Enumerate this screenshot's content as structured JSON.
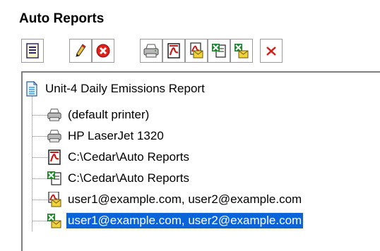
{
  "panel": {
    "title": "Auto Reports"
  },
  "toolbar": [
    {
      "name": "properties-button",
      "icon": "report-list-icon"
    },
    {
      "name": "edit-button",
      "icon": "pencil-icon"
    },
    {
      "name": "stop-button",
      "icon": "red-x-circle-icon"
    },
    {
      "name": "add-printer-button",
      "icon": "printer-icon"
    },
    {
      "name": "add-pdf-file-button",
      "icon": "pdf-file-icon"
    },
    {
      "name": "add-pdf-email-button",
      "icon": "pdf-email-icon"
    },
    {
      "name": "add-excel-file-button",
      "icon": "excel-file-icon"
    },
    {
      "name": "add-excel-email-button",
      "icon": "excel-email-icon"
    },
    {
      "name": "delete-button",
      "icon": "red-x-icon"
    }
  ],
  "tree": {
    "root": {
      "label": "Unit-4 Daily Emissions Report",
      "icon": "report-icon"
    },
    "children": [
      {
        "label": "(default printer)",
        "icon": "printer-icon",
        "selected": false
      },
      {
        "label": "HP LaserJet 1320",
        "icon": "printer-icon",
        "selected": false
      },
      {
        "label": "C:\\Cedar\\Auto Reports",
        "icon": "pdf-file-icon",
        "selected": false
      },
      {
        "label": "C:\\Cedar\\Auto Reports",
        "icon": "excel-file-icon",
        "selected": false
      },
      {
        "label": "user1@example.com, user2@example.com",
        "icon": "pdf-email-icon",
        "selected": false
      },
      {
        "label": "user1@example.com, user2@example.com",
        "icon": "excel-email-icon",
        "selected": true
      }
    ]
  },
  "colors": {
    "selection": "#0a64d8",
    "pdf": "#c81818",
    "excel": "#1e8a2e",
    "envelope": "#f2d23c"
  }
}
